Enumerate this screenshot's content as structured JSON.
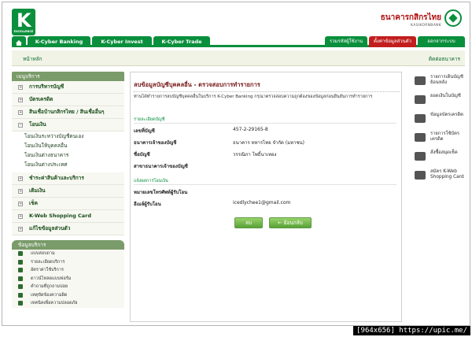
{
  "header": {
    "logo_letter": "K",
    "logo_sub": "EXCELLENCE",
    "bank_name_th": "ธนาคารกสิกรไทย",
    "bank_name_en": "KASIKORNBANK"
  },
  "nav": {
    "tabs": [
      "K-Cyber Banking",
      "K-Cyber Invest",
      "K-Cyber Trade"
    ],
    "right": [
      "รวมรหัสผู้ใช้งาน",
      "ตั้งค่าข้อมูลส่วนตัว",
      "ออกจากระบบ"
    ]
  },
  "subbar": {
    "home": "หน้าหลัก",
    "contact": "ติดต่อธนาคาร"
  },
  "sidebar": {
    "menu_title": "เมนูบริการ",
    "items": [
      {
        "sign": "+",
        "label": "การบริหารบัญชี"
      },
      {
        "sign": "+",
        "label": "บัตรเครดิต"
      },
      {
        "sign": "+",
        "label": "สินเชื่อบ้านกสิกรไทย / สินเชื่ออื่นๆ"
      },
      {
        "sign": "−",
        "label": "โอนเงิน"
      }
    ],
    "transfer_sub": [
      "โอนเงินระหว่างบัญชีตนเอง",
      "โอนเงินให้บุคคลอื่น",
      "โอนเงินต่างธนาคาร",
      "โอนเงินต่างประเทศ"
    ],
    "items2": [
      {
        "sign": "+",
        "label": "ชำระค่าสินค้าและบริการ"
      },
      {
        "sign": "+",
        "label": "เติมเงิน"
      },
      {
        "sign": "+",
        "label": "เช็ค"
      },
      {
        "sign": "+",
        "label": "K-Web Shopping Card"
      },
      {
        "sign": "+",
        "label": "แก้ไขข้อมูลส่วนตัว"
      }
    ],
    "info_title": "ข้อมูลบริการ",
    "info_items": [
      "แบบสอบถาม",
      "รายละเอียดบริการ",
      "อัตราค่าใช้บริการ",
      "ดาวน์โหลดแบบฟอร์ม",
      "คำถามที่ถูกถามบ่อย",
      "เหตุขัดข้องความผิด",
      "เทคนิคเพื่อความปลอดภัย"
    ]
  },
  "main": {
    "title": "ลบข้อมูลบัญชีบุคคลอื่น - ตรวจสอบการทำรายการ",
    "description": "ท่านได้ทำรายการลบบัญชีบุคคลอื่นในบริการ K-Cyber Banking กรุณาตรวจสอบความถูกต้องของข้อมูลก่อนยืนยันการทำรายการ",
    "section1": "รายละเอียดบัญชี",
    "fields": [
      {
        "label": "เลขที่บัญชี",
        "value": "457-2-29165-8"
      },
      {
        "label": "ธนาคารเจ้าของบัญชี",
        "value": "ธนาคาร ทหารไทย จำกัด (มหาชน)"
      },
      {
        "label": "ชื่อบัญชี",
        "value": "วรรณิภา โพธิ์นาเทอง"
      },
      {
        "label": "สาขาธนาคารเจ้าของบัญชี",
        "value": ""
      }
    ],
    "section2": "แจ้งผลการโอนเงิน",
    "notify": [
      {
        "label": "หมายเลขโทรศัพท์ผู้รับโอน",
        "value": ""
      },
      {
        "label": "อีเมล์ผู้รับโอน",
        "value": "icedlychee1@gmail.com"
      }
    ],
    "delete_label": "ลบ",
    "back_label": "ย้อนกลับ"
  },
  "rail": {
    "items": [
      "รายการเดินบัญชีย้อนหลัง",
      "ยอดเงินในบัญชี",
      "ข้อมูลบัตรเครดิต",
      "รายการใช้บัตรเครดิต",
      "สั่งซื้อสมุดเช็ค",
      "สมัคร K-Web Shopping Card"
    ]
  },
  "watermark": "[964x656] https://upic.me/"
}
